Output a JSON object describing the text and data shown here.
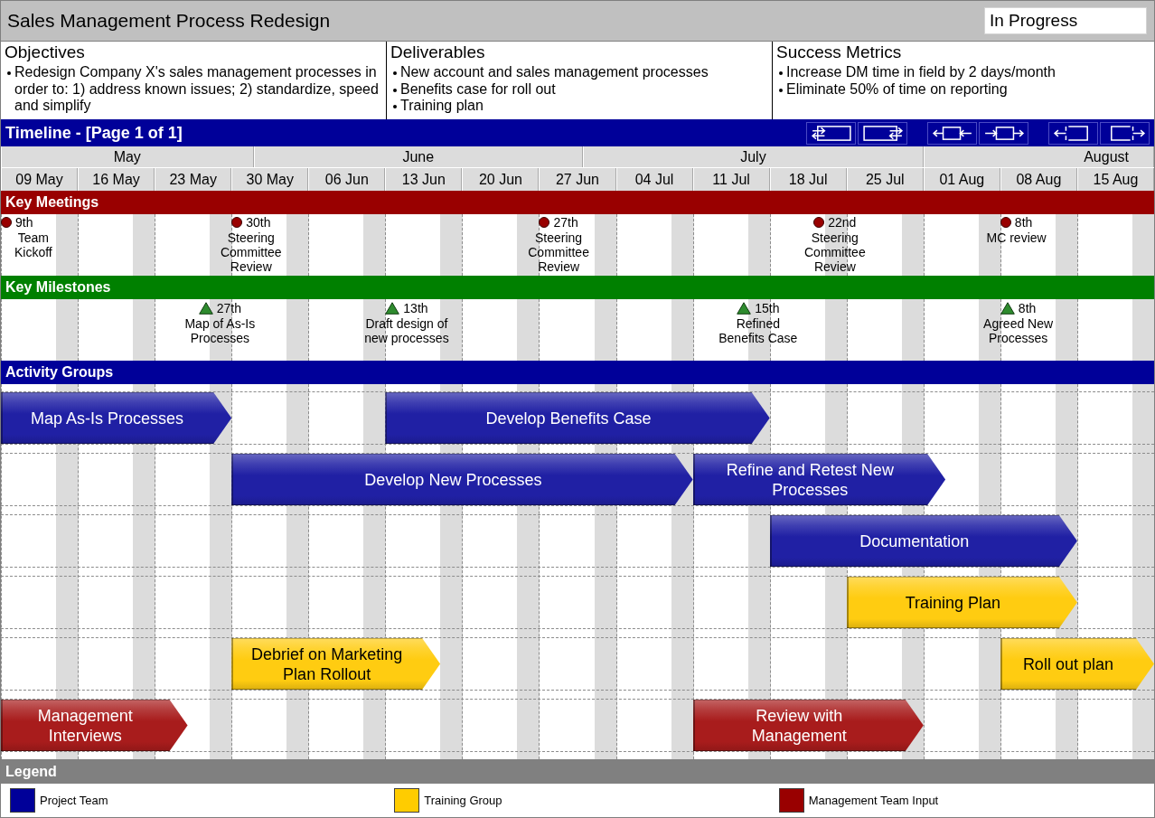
{
  "header": {
    "title": "Sales Management Process Redesign",
    "status": "In Progress"
  },
  "panels": [
    {
      "heading": "Objectives",
      "bullets": [
        "Redesign Company X's sales management processes in order to: 1) address known issues; 2) standardize, speed and simplify"
      ]
    },
    {
      "heading": "Deliverables",
      "bullets": [
        "New account and sales management processes",
        "Benefits case for roll out",
        "Training plan"
      ]
    },
    {
      "heading": "Success Metrics",
      "bullets": [
        "Increase DM time in field by 2 days/month",
        "Eliminate 50% of time on reporting"
      ]
    }
  ],
  "timeline": {
    "title": "Timeline - [Page 1 of 1]",
    "months": [
      "May",
      "June",
      "July",
      "August"
    ],
    "weeks": [
      "09 May",
      "16 May",
      "23 May",
      "30 May",
      "06 Jun",
      "13 Jun",
      "20 Jun",
      "27 Jun",
      "04 Jul",
      "11 Jul",
      "18 Jul",
      "25 Jul",
      "01 Aug",
      "08 Aug",
      "15 Aug"
    ]
  },
  "key_meetings": {
    "title": "Key Meetings",
    "events": [
      {
        "date": "9th",
        "label": "Team\nKickoff"
      },
      {
        "date": "30th",
        "label": "Steering\nCommittee\nReview"
      },
      {
        "date": "27th",
        "label": "Steering\nCommittee\nReview"
      },
      {
        "date": "22nd",
        "label": "Steering\nCommittee\nReview"
      },
      {
        "date": "8th",
        "label": "MC review"
      }
    ]
  },
  "key_milestones": {
    "title": "Key Milestones",
    "events": [
      {
        "date": "27th",
        "label": "Map of As-Is\nProcesses"
      },
      {
        "date": "13th",
        "label": "Draft design of\nnew processes"
      },
      {
        "date": "15th",
        "label": "Refined\nBenefits Case"
      },
      {
        "date": "8th",
        "label": "Agreed New\nProcesses"
      }
    ]
  },
  "activity_groups": {
    "title": "Activity Groups",
    "rows": [
      {
        "bars": [
          {
            "label": "Map As-Is Processes",
            "color": "#2020a4"
          },
          {
            "label": "Develop Benefits Case",
            "color": "#2020a4"
          }
        ]
      },
      {
        "bars": [
          {
            "label": "Develop New Processes",
            "color": "#2020a4"
          },
          {
            "label": "Refine and Retest New\nProcesses",
            "color": "#2020a4"
          }
        ]
      },
      {
        "bars": [
          {
            "label": "Documentation",
            "color": "#2020a4"
          }
        ]
      },
      {
        "bars": [
          {
            "label": "Training Plan",
            "color": "#ffcc11"
          }
        ]
      },
      {
        "bars": [
          {
            "label": "Debrief on Marketing\nPlan Rollout",
            "color": "#ffcc11"
          },
          {
            "label": "Roll out plan",
            "color": "#ffcc11"
          }
        ]
      },
      {
        "bars": [
          {
            "label": "Management\nInterviews",
            "color": "#a81c1c"
          },
          {
            "label": "Review with\nManagement",
            "color": "#a81c1c"
          }
        ]
      }
    ]
  },
  "legend": {
    "title": "Legend",
    "items": [
      {
        "label": "Project Team",
        "color": "#000099"
      },
      {
        "label": "Training Group",
        "color": "#ffcc00"
      },
      {
        "label": "Management Team Input",
        "color": "#990000"
      }
    ]
  }
}
